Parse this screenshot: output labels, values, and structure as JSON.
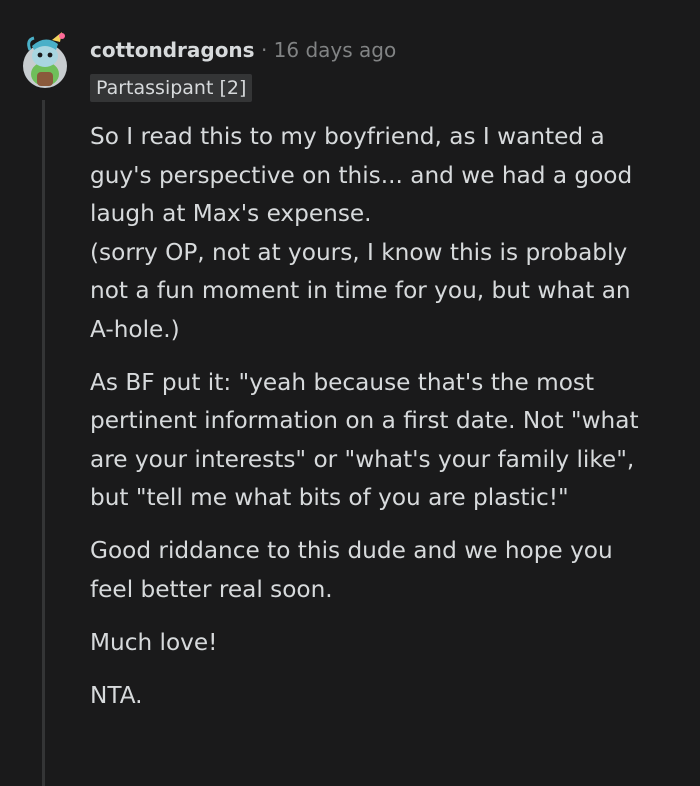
{
  "comment": {
    "username": "cottondragons",
    "separator": "·",
    "timestamp": "16 days ago",
    "flair": "Partassipant [2]",
    "paragraphs": [
      "So I read this to my boyfriend, as I wanted a\nguy's perspective on this... and we had a good\nlaugh at Max's expense.\n(sorry OP, not at yours, I know this is probably\nnot a fun moment in time for you, but what an\nA-hole.)",
      "As BF put it: \"yeah because that's the most\npertinent information on a first date. Not \"what\nare your interests\" or \"what's your family like\",\nbut \"tell me what bits of you are plastic!\"",
      "Good riddance to this dude and we hope you\nfeel better real soon.",
      "Much love!",
      "NTA."
    ]
  },
  "colors": {
    "background": "#1a1a1b",
    "text": "#d7dadc",
    "meta": "#818384",
    "flair_bg": "#343536",
    "thread_line": "#343536"
  },
  "icons": {
    "avatar": "snoo-avatar-icon"
  }
}
